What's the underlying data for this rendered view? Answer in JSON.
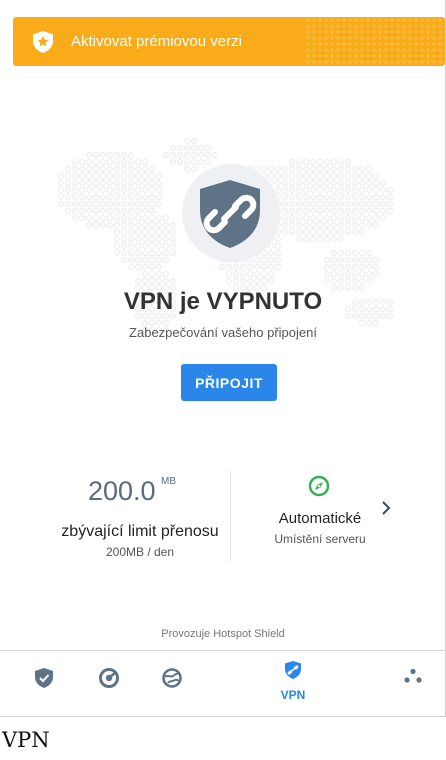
{
  "banner": {
    "label": "Aktivovat prémiovou verzi",
    "icon": "star-shield-icon",
    "color": "#f9ab19"
  },
  "status": {
    "title": "VPN je VYPNUTO",
    "subtitle": "Zabezpečování vašeho připojení"
  },
  "connect_button": {
    "label": "PŘIPOJIT",
    "color": "#2a86e8"
  },
  "data_limit": {
    "value": "200.0",
    "unit": "MB",
    "label": "zbývající limit přenosu",
    "sub": "200MB / den"
  },
  "server": {
    "label": "Automatické",
    "sub": "Umístění serveru",
    "icon": "compass-icon"
  },
  "powered_by": "Provozuje Hotspot Shield",
  "nav": {
    "items": [
      {
        "icon": "security-shield-icon",
        "label": ""
      },
      {
        "icon": "speed-test-icon",
        "label": ""
      },
      {
        "icon": "browser-globe-icon",
        "label": ""
      },
      {
        "icon": "vpn-link-icon",
        "label": "VPN",
        "active": true
      },
      {
        "icon": "more-dots-icon",
        "label": ""
      }
    ]
  },
  "caption": "VPN"
}
